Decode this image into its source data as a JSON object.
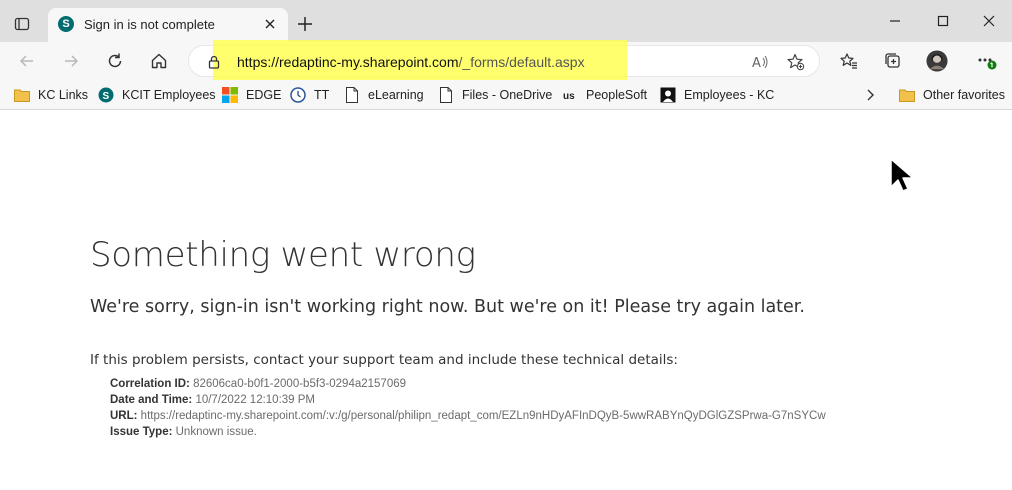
{
  "browser": {
    "tab": {
      "title": "Sign in is not complete",
      "favicon": "sharepoint-icon"
    },
    "address": {
      "host": "https://redaptinc-my.sharepoint.com",
      "path": "/_forms/default.aspx"
    },
    "bookmarks": [
      {
        "label": "KC Links",
        "icon": "folder-icon"
      },
      {
        "label": "KCIT Employees",
        "icon": "sharepoint-icon"
      },
      {
        "label": "EDGE",
        "icon": "windows-logo-icon"
      },
      {
        "label": "TT",
        "icon": "tt-icon"
      },
      {
        "label": "eLearning",
        "icon": "page-icon"
      },
      {
        "label": "Files - OneDrive",
        "icon": "page-icon"
      },
      {
        "label": "PeopleSoft",
        "icon": "peoplesoft-icon"
      },
      {
        "label": "Employees - KC",
        "icon": "kc-icon"
      }
    ],
    "other_favorites": "Other favorites"
  },
  "error": {
    "title": "Something went wrong",
    "subtitle": "We're sorry, sign-in isn't working right now. But we're on it! Please try again later.",
    "hint": "If this problem persists, contact your support team and include these technical details:",
    "details": {
      "correlation_label": "Correlation ID:",
      "correlation_value": "82606ca0-b0f1-2000-b5f3-0294a2157069",
      "datetime_label": "Date and Time:",
      "datetime_value": "10/7/2022 12:10:39 PM",
      "url_label": "URL:",
      "url_value": "https://redaptinc-my.sharepoint.com/:v:/g/personal/philipn_redapt_com/EZLn9nHDyAFInDQyB-5wwRABYnQyDGlGZSPrwa-G7nSYCw",
      "issue_label": "Issue Type:",
      "issue_value": "Unknown issue."
    }
  },
  "colors": {
    "highlight": "#ffff4a",
    "tabbar": "#dfdfdf",
    "toolbar": "#f7f7f7",
    "sharepoint": "#036c70"
  }
}
